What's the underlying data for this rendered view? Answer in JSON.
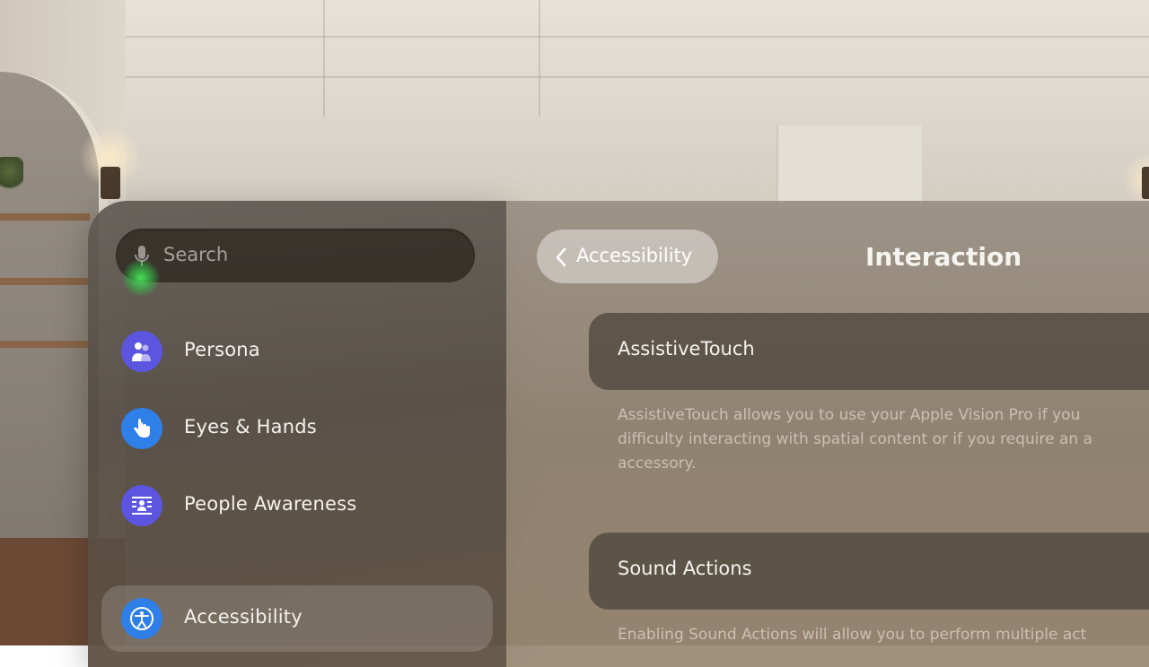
{
  "search": {
    "placeholder": "Search"
  },
  "sidebar": {
    "items": [
      {
        "label": "Persona",
        "icon": "persona-icon",
        "color": "#5b55e0"
      },
      {
        "label": "Eyes & Hands",
        "icon": "hand-pointer-icon",
        "color": "#2f7fe8"
      },
      {
        "label": "People Awareness",
        "icon": "people-awareness-icon",
        "color": "#5b55e0"
      },
      {
        "label": "Accessibility",
        "icon": "accessibility-icon",
        "color": "#2f7fe8",
        "selected": true
      }
    ]
  },
  "detail": {
    "back_label": "Accessibility",
    "title": "Interaction",
    "rows": [
      {
        "label": "AssistiveTouch",
        "description": "AssistiveTouch allows you to use your Apple Vision Pro if you\ndifficulty interacting with spatial content or if you require an a\naccessory."
      },
      {
        "label": "Sound Actions",
        "description": "Enabling Sound Actions will allow you to perform multiple act"
      }
    ]
  },
  "colors": {
    "mic_active": "#3ed65a",
    "accent_purple": "#5b55e0",
    "accent_blue": "#2f7fe8"
  }
}
